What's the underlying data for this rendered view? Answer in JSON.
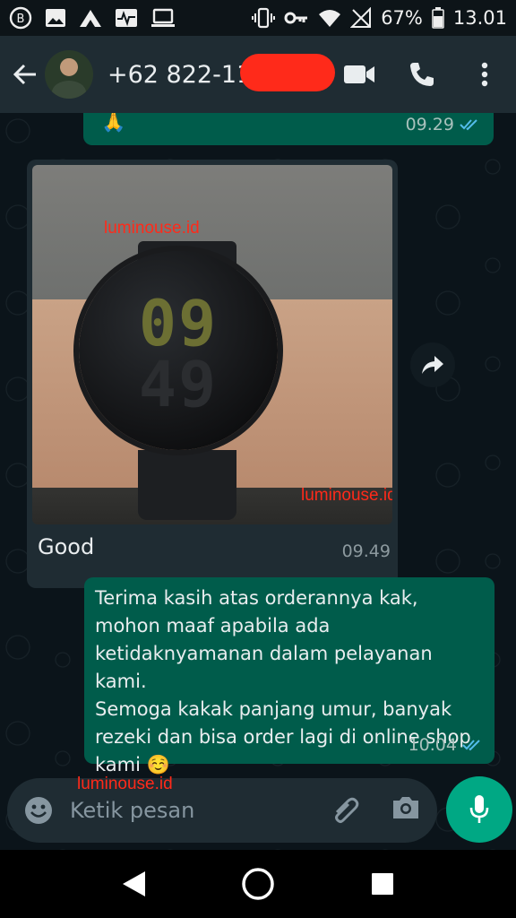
{
  "status_bar": {
    "battery": "67%",
    "time": "13.01",
    "icons": [
      "b-icon",
      "image-icon",
      "signal-app-icon",
      "pulse-icon",
      "laptop-icon",
      "vibrate-icon",
      "key-icon",
      "wifi-icon",
      "no-signal-icon",
      "battery-icon"
    ]
  },
  "header": {
    "contact": "+62 822-112",
    "icons": [
      "back-arrow-icon",
      "video-call-icon",
      "phone-icon",
      "more-icon"
    ]
  },
  "messages": [
    {
      "type": "outgoing",
      "text": "🙏",
      "time": "09.29",
      "status": "read"
    },
    {
      "type": "incoming",
      "image": {
        "hours": "09",
        "minutes": "49"
      },
      "caption": "Good",
      "time": "09.49"
    },
    {
      "type": "outgoing",
      "lines": [
        "Terima kasih atas orderannya kak, mohon maaf apabila ada ketidaknyamanan dalam pelayanan kami.",
        "Semoga kakak panjang umur, banyak rezeki dan bisa order lagi di online shop kami ☺️"
      ],
      "time": "10.04",
      "status": "read"
    }
  ],
  "watermarks": [
    "luminouse.id",
    "luminouse.id",
    "luminouse.id"
  ],
  "composer": {
    "placeholder": "Ketik pesan"
  },
  "colors": {
    "outgoing": "#005c4b",
    "incoming": "#1f2c33",
    "accent": "#00a884",
    "ticks": "#53bdeb",
    "watermark": "#ff2a1a"
  }
}
